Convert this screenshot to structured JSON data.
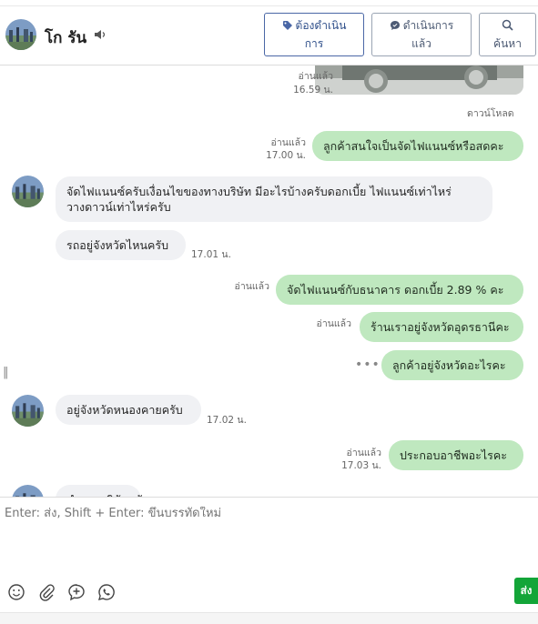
{
  "header": {
    "contact_name": "โก รัน",
    "buttons": {
      "todo_line1": "ต้องดำเนิน",
      "todo_line2": "การ",
      "done_line1": "ดำเนินการ",
      "done_line2": "แล้ว",
      "search": "ค้นหา"
    }
  },
  "chat": {
    "top_photo_meta": {
      "read": "อ่านแล้ว",
      "time": "16.59 น."
    },
    "download_label": "ดาวน์โหลด",
    "messages": [
      {
        "direction": "out",
        "text": "ลูกค้าสนใจเป็นจัดไฟแนนซ์หรือสดคะ",
        "read": "อ่านแล้ว",
        "time": "17.00 น."
      },
      {
        "direction": "in",
        "line1": "จัดไฟแนนซ์ครับเงื่อนไขของทางบริษัท มีอะไรบ้างครับดอกเบี้ย ไฟแนนซ์เท่าไหร่",
        "line2": "วางดาวน์เท่าไหร่ครับ"
      },
      {
        "direction": "in",
        "text": "รถอยู่จังหวัดไหนครับ",
        "time": "17.01 น."
      },
      {
        "direction": "out",
        "text": "จัดไฟแนนซ์กับธนาคาร ดอกเบี้ย 2.89 %  คะ",
        "read": "อ่านแล้ว"
      },
      {
        "direction": "out",
        "text": "ร้านเราอยู่จังหวัดอุดรธานีคะ",
        "read": "อ่านแล้ว"
      },
      {
        "direction": "out",
        "text": "ลูกค้าอยู่จังหวัดอะไรคะ",
        "status": "•••"
      },
      {
        "direction": "in",
        "text": "อยู่จังหวัดหนองคายครับ",
        "time": "17.02 น."
      },
      {
        "direction": "out",
        "text": "ประกอบอาชีพอะไรคะ",
        "read": "อ่านแล้ว",
        "time": "17.03 น."
      },
      {
        "direction": "in",
        "text": "ทำงานบริษัทครับ"
      }
    ]
  },
  "composer": {
    "placeholder": "Enter: ส่ง, Shift + Enter: ขึ้นบรรทัดใหม่",
    "send_label": "ส่ง",
    "tools": [
      "emoji-icon",
      "attachment-icon",
      "add-icon",
      "whatsapp-icon"
    ]
  },
  "colors": {
    "outgoing_bubble": "#bfe8bf",
    "incoming_bubble": "#f0f1f4",
    "button_border": "#4a67a6",
    "send_button": "#13a538"
  }
}
